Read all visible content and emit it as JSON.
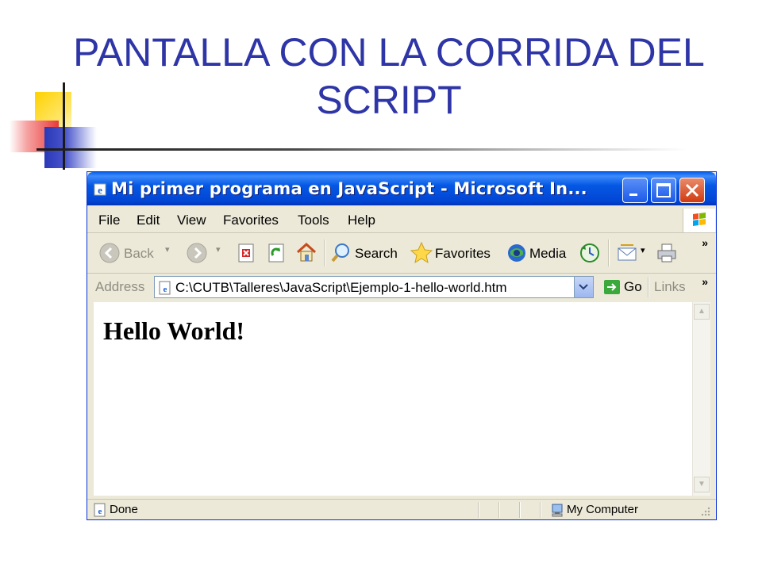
{
  "slide": {
    "title_line1": "PANTALLA CON LA CORRIDA DEL",
    "title_line2": "SCRIPT",
    "title_color": "#2e35a6"
  },
  "window": {
    "title": "Mi primer programa en JavaScript - Microsoft In...",
    "title_icon": "ie-icon",
    "controls": [
      "minimize-button",
      "maximize-button",
      "close-button"
    ]
  },
  "menubar": {
    "items": [
      {
        "label": "File",
        "accel": "F"
      },
      {
        "label": "Edit",
        "accel": "E"
      },
      {
        "label": "View",
        "accel": "V"
      },
      {
        "label": "Favorites",
        "accel": "a"
      },
      {
        "label": "Tools",
        "accel": "T"
      },
      {
        "label": "Help",
        "accel": "H"
      }
    ]
  },
  "toolbar": {
    "back_label": "Back",
    "search_label": "Search",
    "favorites_label": "Favorites",
    "media_label": "Media",
    "more": "»"
  },
  "addressbar": {
    "label": "Address",
    "value": "C:\\CUTB\\Talleres\\JavaScript\\Ejemplo-1-hello-world.htm",
    "go_label": "Go",
    "links_label": "Links",
    "more": "»"
  },
  "content": {
    "text": "Hello World!"
  },
  "statusbar": {
    "status": "Done",
    "zone": "My Computer"
  }
}
